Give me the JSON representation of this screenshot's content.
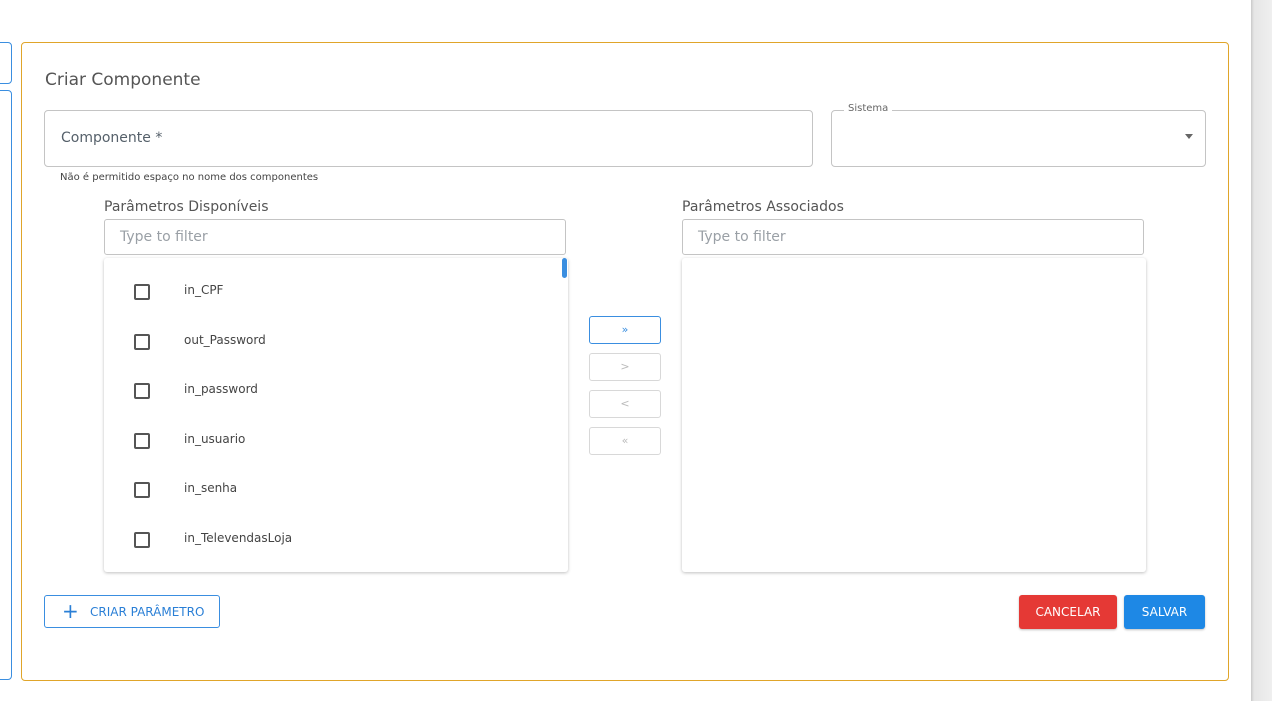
{
  "card": {
    "title": "Criar Componente"
  },
  "form": {
    "componente_placeholder": "Componente *",
    "sistema_label": "Sistema",
    "helper_text": "Não é permitido espaço no nome dos componentes"
  },
  "lists": {
    "available_label": "Parâmetros Disponíveis",
    "associated_label": "Parâmetros Associados",
    "filter_placeholder": "Type to filter",
    "available_items": [
      "in_CPF",
      "out_Password",
      "in_password",
      "in_usuario",
      "in_senha",
      "in_TelevendasLoja"
    ]
  },
  "move_buttons": {
    "all_right": "»",
    "right": ">",
    "left": "<",
    "all_left": "«"
  },
  "actions": {
    "create_param": "CRIAR PARÂMETRO",
    "cancel": "CANCELAR",
    "save": "SALVAR"
  },
  "colors": {
    "accent": "#1e88e5",
    "danger": "#e53935",
    "card_border": "#e0a52a"
  }
}
